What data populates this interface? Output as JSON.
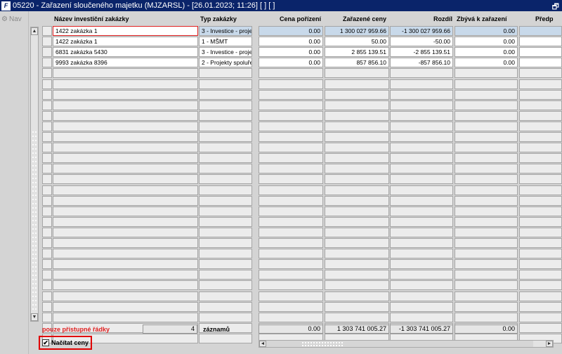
{
  "window": {
    "title": "05220 - Zařazení sloučeného majetku (MJZARSL) - [26.01.2023; 11:26]  [ ]  [ ]",
    "app_icon": "app-logo-icon",
    "restore_glyph": "🗗"
  },
  "nav": {
    "label": "Nav",
    "icon": "nav-icon"
  },
  "headers": {
    "nazev": "Název investiční zakázky",
    "typ": "Typ zakázky",
    "cena": "Cena pořízení",
    "zarazene": "Zařazené ceny",
    "rozdil": "Rozdíl",
    "zbyva": "Zbývá k zařazení",
    "predp": "Předp"
  },
  "rows": [
    {
      "nazev": "1422 zakázka 1",
      "typ": "3 - Investice - proje",
      "cena": "0.00",
      "zarazene": "1 300 027 959.66",
      "rozdil": "-1 300 027 959.66",
      "zbyva": "0.00"
    },
    {
      "nazev": "1422 zakázka 1",
      "typ": "1 - MŠMT",
      "cena": "0.00",
      "zarazene": "50.00",
      "rozdil": "-50.00",
      "zbyva": "0.00"
    },
    {
      "nazev": "6831 zakázka 5430",
      "typ": "3 - Investice - proje",
      "cena": "0.00",
      "zarazene": "2 855 139.51",
      "rozdil": "-2 855 139.51",
      "zbyva": "0.00"
    },
    {
      "nazev": "9993 zakázka 8396",
      "typ": "2 - Projekty spoluře",
      "cena": "0.00",
      "zarazene": "857 856.10",
      "rozdil": "-857 856.10",
      "zbyva": "0.00"
    }
  ],
  "empty_row_count": 26,
  "footer": {
    "filter_label": "pouze přístupné řádky",
    "record_count": "4",
    "records_label": "záznamů",
    "sum_cena": "0.00",
    "sum_zarazene": "1 303 741 005.27",
    "sum_rozdil": "-1 303 741 005.27",
    "sum_zbyva": "0.00"
  },
  "checkbox": {
    "label": "Načítat ceny",
    "checked": true,
    "mark": "✔"
  },
  "scroll": {
    "up": "▲",
    "down": "▼",
    "left": "◄",
    "right": "►"
  },
  "colors": {
    "titlebar": "#0a246a",
    "highlight": "#c8d9ea",
    "accent_red": "#e02020"
  }
}
